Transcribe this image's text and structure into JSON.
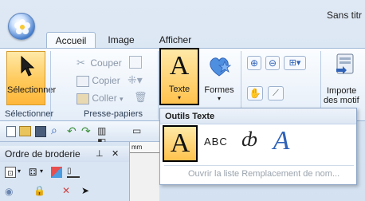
{
  "window": {
    "title": "Sans titr"
  },
  "tabs": [
    {
      "label": "Accueil",
      "active": true
    },
    {
      "label": "Image",
      "active": false
    },
    {
      "label": "Afficher",
      "active": false
    }
  ],
  "ribbon": {
    "select_label": "Sélectionner",
    "clipboard": {
      "cut": "Couper",
      "copy": "Copier",
      "paste": "Coller"
    },
    "text_button": "Texte",
    "shapes_button": "Formes",
    "import_line1": "Importe",
    "import_line2": "des motif",
    "groups": {
      "selection": "Sélectionner",
      "clipboard": "Presse-papiers"
    }
  },
  "dropdown": {
    "header": "Outils Texte",
    "abc_label": "ABC",
    "replace_link": "Ouvrir la liste Remplacement de nom..."
  },
  "panel": {
    "title": "Ordre de broderie",
    "pin": "ᵖ",
    "close": "✕",
    "ruler_unit": "mm"
  },
  "colors": {
    "accent": "#ffc24d",
    "ribbon_border": "#9fb8d6",
    "icon_blue": "#2f62b8"
  }
}
